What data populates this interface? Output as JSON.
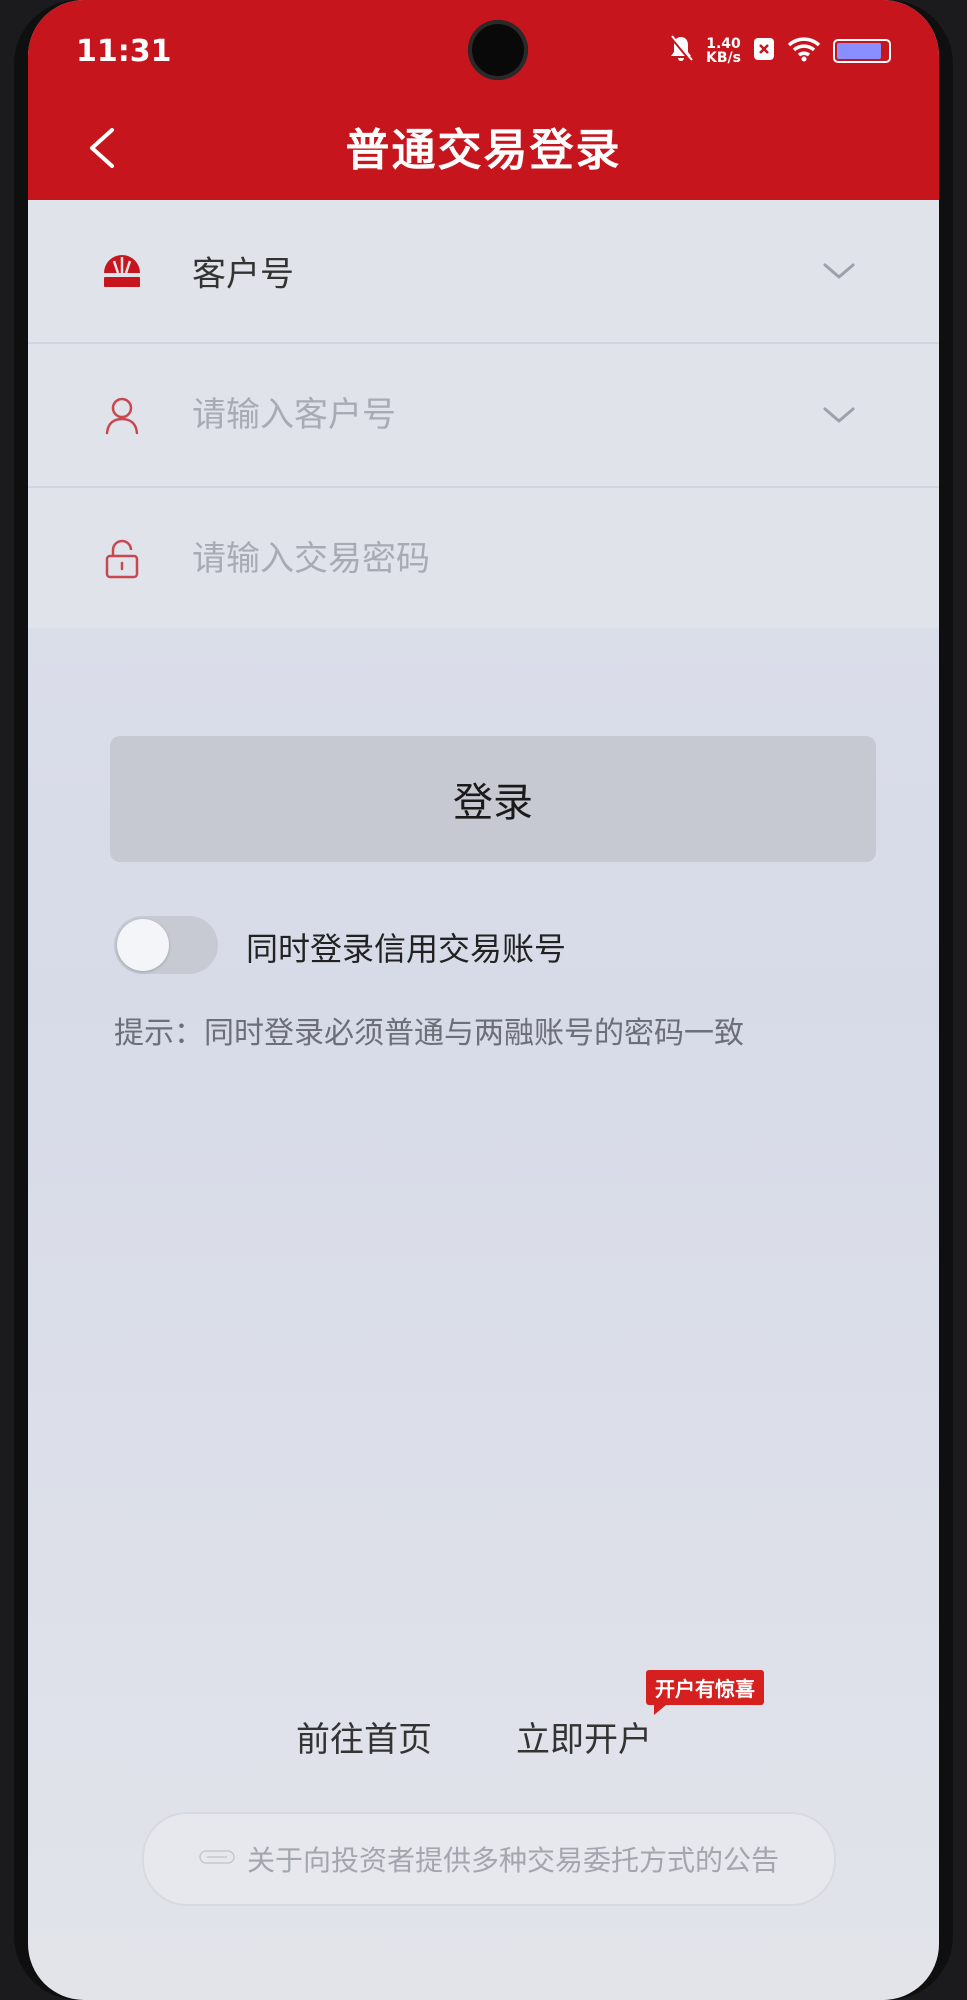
{
  "status_bar": {
    "time": "11:31",
    "speed_value": "1.40",
    "speed_unit": "KB/s"
  },
  "header": {
    "title": "普通交易登录"
  },
  "form": {
    "account_type": "客户号",
    "customer_placeholder": "请输入客户号",
    "password_placeholder": "请输入交易密码"
  },
  "login_button": "登录",
  "credit_toggle": {
    "label": "同时登录信用交易账号",
    "on": false
  },
  "hint": "提示：同时登录必须普通与两融账号的密码一致",
  "footer": {
    "home_link": "前往首页",
    "open_account_link": "立即开户",
    "open_account_badge": "开户有惊喜"
  },
  "notice": {
    "text": "关于向投资者提供多种交易委托方式的公告"
  },
  "colors": {
    "brand_red": "#c7151d",
    "icon_red": "#c9474f"
  }
}
